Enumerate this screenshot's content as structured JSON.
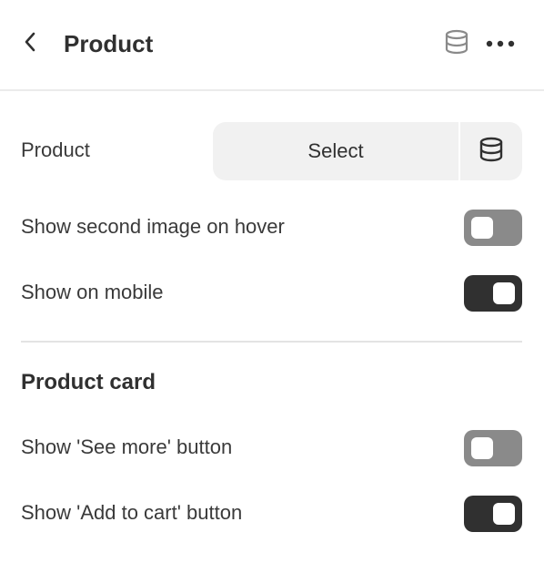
{
  "header": {
    "title": "Product",
    "back_icon": "chevron-left-icon",
    "data_source_icon": "database-icon",
    "more_icon": "more-horizontal-icon"
  },
  "settings": {
    "product": {
      "label": "Product",
      "select_label": "Select",
      "source_icon": "database-icon"
    },
    "second_image": {
      "label": "Show second image on hover",
      "enabled": false
    },
    "mobile": {
      "label": "Show on mobile",
      "enabled": true
    }
  },
  "product_card": {
    "title": "Product card",
    "see_more": {
      "label": "Show 'See more' button",
      "enabled": false
    },
    "add_to_cart": {
      "label": "Show 'Add to cart' button",
      "enabled": true
    }
  },
  "colors": {
    "toggle_on": "#303030",
    "toggle_off": "#8a8a8a",
    "button_bg": "#f1f1f1",
    "text": "#303030"
  }
}
